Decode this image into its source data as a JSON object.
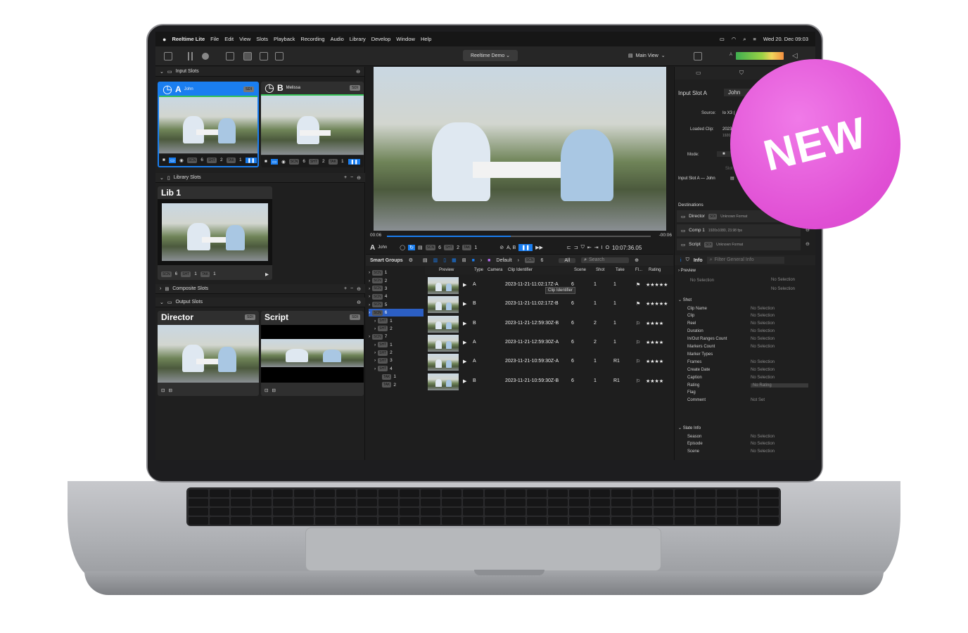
{
  "menubar": {
    "app": "Reeltime Lite",
    "items": [
      "File",
      "Edit",
      "View",
      "Slots",
      "Playback",
      "Recording",
      "Audio",
      "Library",
      "Develop",
      "Window",
      "Help"
    ],
    "clock": "Wed 20. Dec 09:03"
  },
  "toolbar": {
    "project": "Reeltime Demo",
    "view": "Main View",
    "meter_label": "A"
  },
  "input_slots": {
    "title": "Input Slots",
    "slots": [
      {
        "letter": "A",
        "name": "John",
        "badge": "SDI",
        "scn": "SCN",
        "scn_v": "6",
        "sht": "SHT",
        "sht_v": "2",
        "tak": "TAK",
        "tak_v": "1"
      },
      {
        "letter": "B",
        "name": "Melissa",
        "badge": "SDI",
        "scn": "SCN",
        "scn_v": "6",
        "sht": "SHT",
        "sht_v": "2",
        "tak": "TAK",
        "tak_v": "1"
      }
    ]
  },
  "library_slots": {
    "title": "Library Slots",
    "slot": {
      "name": "Lib 1",
      "scn_v": "6",
      "sht_v": "1",
      "tak_v": "1"
    }
  },
  "composite_slots": {
    "title": "Composite Slots"
  },
  "output_slots": {
    "title": "Output Slots",
    "slots": [
      {
        "name": "Director",
        "badge": "SDI"
      },
      {
        "name": "Script",
        "badge": "SDI"
      }
    ]
  },
  "viewer": {
    "time_start": "00:06",
    "time_end": "-00:06",
    "progress": 0.47,
    "slot_letter": "A",
    "slot_name": "John",
    "scn_v": "6",
    "sht_v": "2",
    "tak_v": "1",
    "ab_label": "A, B",
    "timecode": "10:07:36.05"
  },
  "browser": {
    "smart_groups": "Smart Groups",
    "breadcrumb": "Default",
    "breadcrumb_count": "6",
    "filter": "All",
    "search_placeholder": "Search",
    "tree": [
      {
        "label": "1",
        "depth": 0
      },
      {
        "label": "2",
        "depth": 0
      },
      {
        "label": "3",
        "depth": 0
      },
      {
        "label": "4",
        "depth": 0
      },
      {
        "label": "5",
        "depth": 0
      },
      {
        "label": "6",
        "depth": 0,
        "selected": true
      },
      {
        "label": "1",
        "depth": 1
      },
      {
        "label": "2",
        "depth": 1
      },
      {
        "label": "7",
        "depth": 0
      },
      {
        "label": "1",
        "depth": 1
      },
      {
        "label": "2",
        "depth": 1
      },
      {
        "label": "3",
        "depth": 1
      },
      {
        "label": "4",
        "depth": 1
      },
      {
        "label": "1",
        "depth": 2
      },
      {
        "label": "2",
        "depth": 2
      }
    ],
    "columns": [
      "Preview",
      "Type",
      "Camera",
      "Clip Identifier",
      "Scene",
      "Shot",
      "Take",
      "Fl...",
      "Rating"
    ],
    "tooltip": "Clip Identifier",
    "rows": [
      {
        "camera": "A",
        "clip": "2023-11-21-11:02:17Z-A",
        "scene": "6",
        "shot": "1",
        "take": "1",
        "rating": "★★★★★"
      },
      {
        "camera": "B",
        "clip": "2023-11-21-11:02:17Z-B",
        "scene": "6",
        "shot": "1",
        "take": "1",
        "rating": "★★★★★"
      },
      {
        "camera": "B",
        "clip": "2023-11-21-12:59:30Z-B",
        "scene": "6",
        "shot": "2",
        "take": "1",
        "rating": "★★★★"
      },
      {
        "camera": "A",
        "clip": "2023-11-21-12:59:30Z-A",
        "scene": "6",
        "shot": "2",
        "take": "1",
        "rating": "★★★★"
      },
      {
        "camera": "A",
        "clip": "2023-11-21-10:59:30Z-A",
        "scene": "6",
        "shot": "1",
        "take": "R1",
        "rating": "★★★★"
      },
      {
        "camera": "B",
        "clip": "2023-11-21-10:59:30Z-B",
        "scene": "6",
        "shot": "1",
        "take": "R1",
        "rating": "★★★★"
      }
    ]
  },
  "inspector": {
    "title": "Input Slot A",
    "title_value": "John",
    "source_label": "Source:",
    "source_value": "Io X3 (",
    "loaded_label": "Loaded Clip:",
    "loaded_value": "2023",
    "loaded_sub": "1920",
    "mode_label": "Mode:",
    "slot_hint": "Slot",
    "slot_line": "Input Slot A — John",
    "destinations_title": "Destinations",
    "destinations": [
      {
        "name": "Director",
        "badge": "SDI",
        "format": "Unknown Format"
      },
      {
        "name": "Comp 1",
        "badge": "",
        "format": "1920x1080, 23.98 fps"
      },
      {
        "name": "Script",
        "badge": "SDI",
        "format": "Unknown Format"
      }
    ],
    "info_tab": "Info",
    "filter_placeholder": "Filter General Info",
    "preview_label": "Preview",
    "no_selection": "No Selection",
    "shot_section": "Shot",
    "shot_fields": [
      {
        "k": "Clip Name",
        "v": "No Selection"
      },
      {
        "k": "Clip",
        "v": "No Selection"
      },
      {
        "k": "Reel",
        "v": "No Selection"
      },
      {
        "k": "Duration",
        "v": "No Selection"
      },
      {
        "k": "In/Out Ranges Count",
        "v": "No Selection"
      },
      {
        "k": "Markers Count",
        "v": "No Selection"
      },
      {
        "k": "Marker Types",
        "v": ""
      },
      {
        "k": "Frames",
        "v": "No Selection"
      },
      {
        "k": "Create Date",
        "v": "No Selection"
      },
      {
        "k": "Caption",
        "v": "No Selection"
      },
      {
        "k": "Rating",
        "v": "No Rating"
      },
      {
        "k": "Flag",
        "v": ""
      },
      {
        "k": "Comment",
        "v": "Not Set"
      }
    ],
    "slate_section": "Slate Info",
    "slate_fields": [
      {
        "k": "Season",
        "v": "No Selection"
      },
      {
        "k": "Episode",
        "v": "No Selection"
      },
      {
        "k": "Scene",
        "v": "No Selection"
      }
    ]
  },
  "badge": {
    "text": "NEW"
  },
  "colors": {
    "accent": "#0a84ff",
    "badge": "#e04fd4",
    "selection": "#2c5fc4"
  }
}
